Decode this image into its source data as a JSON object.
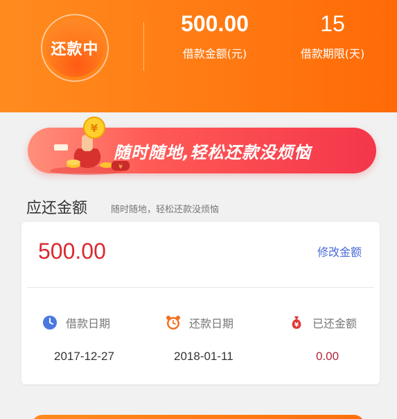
{
  "header": {
    "status": "还款中",
    "loan_amount": {
      "value": "500.00",
      "label": "借款金额(元)"
    },
    "loan_term": {
      "value": "15",
      "label": "借款期限(天)"
    }
  },
  "banner": {
    "text": "随时随地,轻松还款没烦恼"
  },
  "section": {
    "title": "应还金额",
    "subtitle": "随时随地，轻松还款没烦恼"
  },
  "card": {
    "amount": "500.00",
    "edit_label": "修改金额",
    "columns": [
      {
        "icon": "clock-icon",
        "label": "借款日期",
        "value": "2017-12-27"
      },
      {
        "icon": "alarm-clock-icon",
        "label": "还款日期",
        "value": "2018-01-11"
      },
      {
        "icon": "money-bag-icon",
        "label": "已还金额",
        "value": "0.00"
      }
    ]
  },
  "colors": {
    "primary_orange": "#ff7a12",
    "amount_red": "#d9292f",
    "link_blue": "#4b6bd6"
  }
}
